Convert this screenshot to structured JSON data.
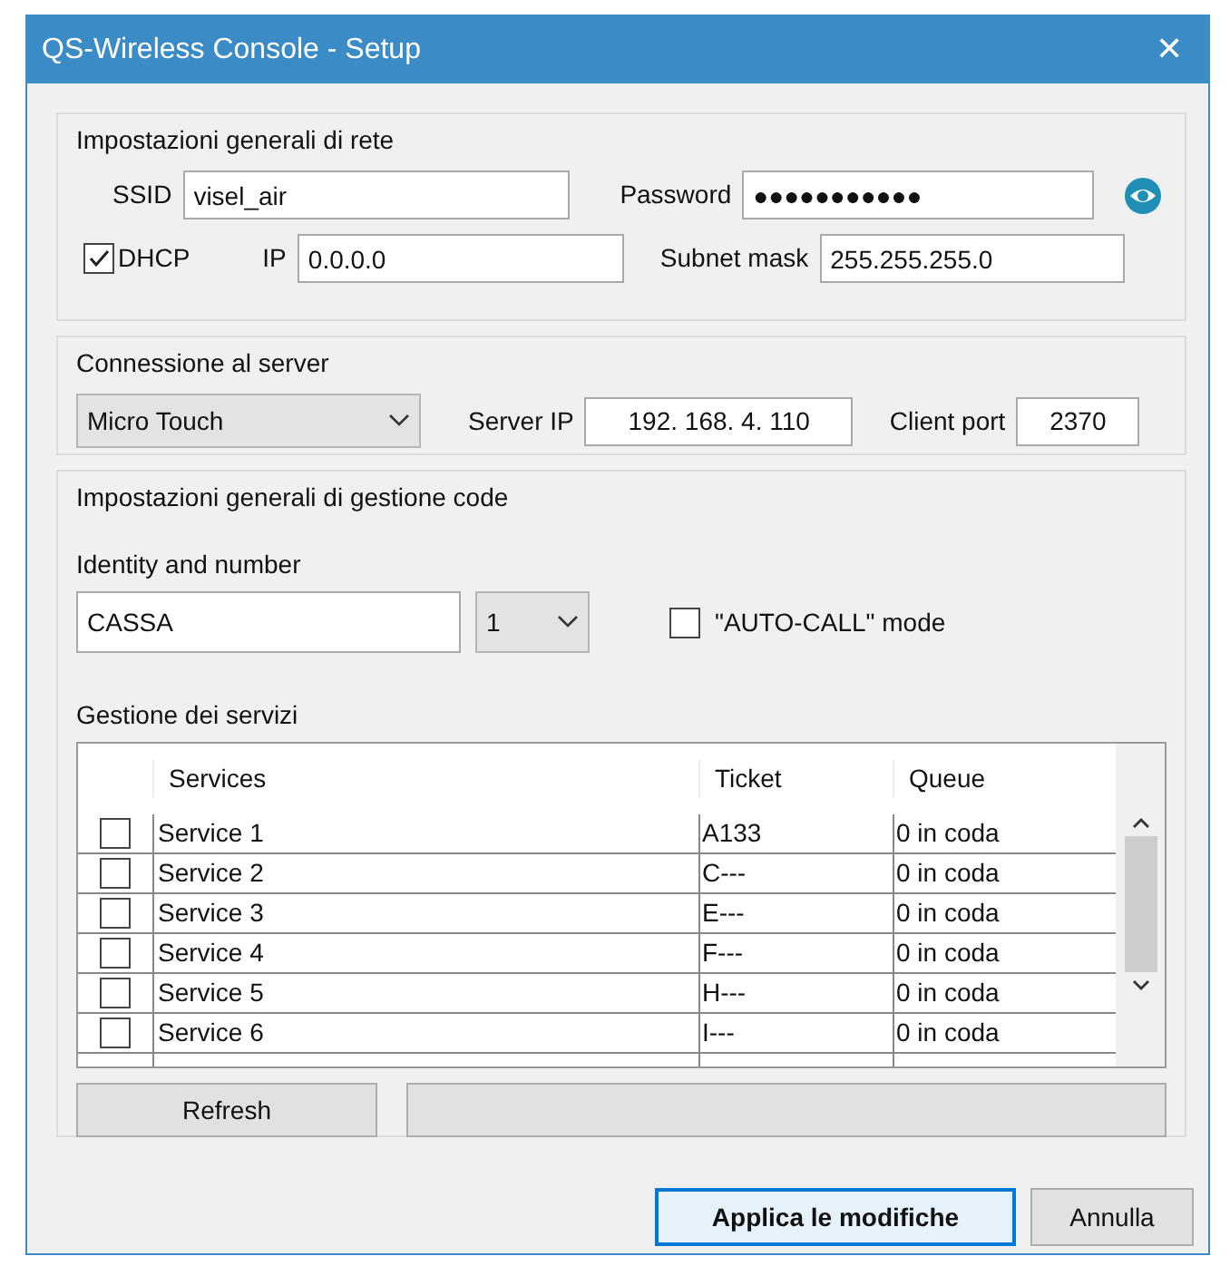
{
  "window": {
    "title": "QS-Wireless Console - Setup",
    "close": "✕"
  },
  "network": {
    "legend": "Impostazioni generali di rete",
    "ssid_label": "SSID",
    "ssid": "visel_air",
    "password_label": "Password",
    "password": "●●●●●●●●●●●",
    "dhcp": {
      "label": "DHCP",
      "checked": true
    },
    "ip_label": "IP",
    "ip": "0.0.0.0",
    "subnet_label": "Subnet mask",
    "subnet": "255.255.255.0"
  },
  "server": {
    "legend": "Connessione al server",
    "device": "Micro Touch",
    "server_ip_label": "Server IP",
    "server_ip": "192. 168. 4. 110",
    "client_port_label": "Client port",
    "client_port": "2370"
  },
  "queue": {
    "legend": "Impostazioni generali di gestione code",
    "identity_label": "Identity and number",
    "identity": "CASSA",
    "number": "1",
    "autocall": {
      "label": "\"AUTO-CALL\" mode",
      "checked": false
    },
    "services_label": "Gestione dei servizi",
    "table": {
      "columns": [
        "Services",
        "Ticket",
        "Queue"
      ],
      "rows": [
        {
          "checked": false,
          "cells": [
            "Service 1",
            "A133",
            "0 in coda"
          ]
        },
        {
          "checked": false,
          "cells": [
            "Service 2",
            "C---",
            "0 in coda"
          ]
        },
        {
          "checked": false,
          "cells": [
            "Service 3",
            "E---",
            "0 in coda"
          ]
        },
        {
          "checked": false,
          "cells": [
            "Service 4",
            "F---",
            "0 in coda"
          ]
        },
        {
          "checked": false,
          "cells": [
            "Service 5",
            "H---",
            "0 in coda"
          ]
        },
        {
          "checked": false,
          "cells": [
            "Service 6",
            "I---",
            "0 in coda"
          ]
        }
      ]
    },
    "refresh": "Refresh"
  },
  "buttons": [
    {
      "label": "Applica le modifiche",
      "kind": "default"
    },
    {
      "label": "Annulla",
      "kind": "normal"
    }
  ]
}
